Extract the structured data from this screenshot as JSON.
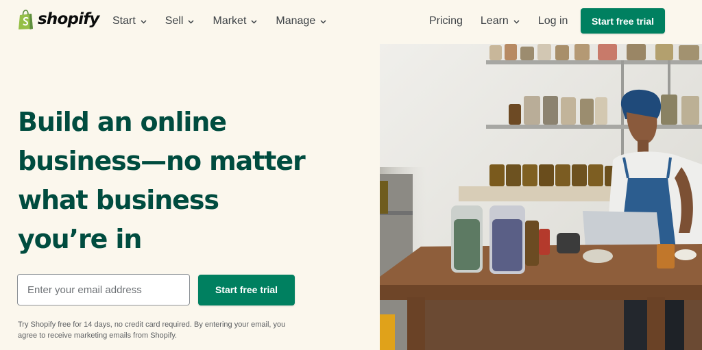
{
  "brand": {
    "name": "shopify",
    "color": "#008060",
    "logo_bag_color": "#95bf47"
  },
  "nav": {
    "left": [
      {
        "label": "Start",
        "has_dropdown": true
      },
      {
        "label": "Sell",
        "has_dropdown": true
      },
      {
        "label": "Market",
        "has_dropdown": true
      },
      {
        "label": "Manage",
        "has_dropdown": true
      }
    ],
    "right": [
      {
        "label": "Pricing",
        "has_dropdown": false
      },
      {
        "label": "Learn",
        "has_dropdown": true
      },
      {
        "label": "Log in",
        "has_dropdown": false
      }
    ],
    "cta_label": "Start free trial"
  },
  "hero": {
    "title_lines": [
      "Build an online",
      "business—no matter",
      "what business",
      "you’re in"
    ],
    "title_color": "#004c3f",
    "email_placeholder": "Enter your email address",
    "email_value": "",
    "submit_label": "Start free trial",
    "disclaimer": "Try Shopify free for 14 days, no credit card required. By entering your email, you agree to receive marketing emails from Shopify."
  },
  "photo": {
    "icon": "woman-working-on-laptop-with-jars-photo"
  }
}
